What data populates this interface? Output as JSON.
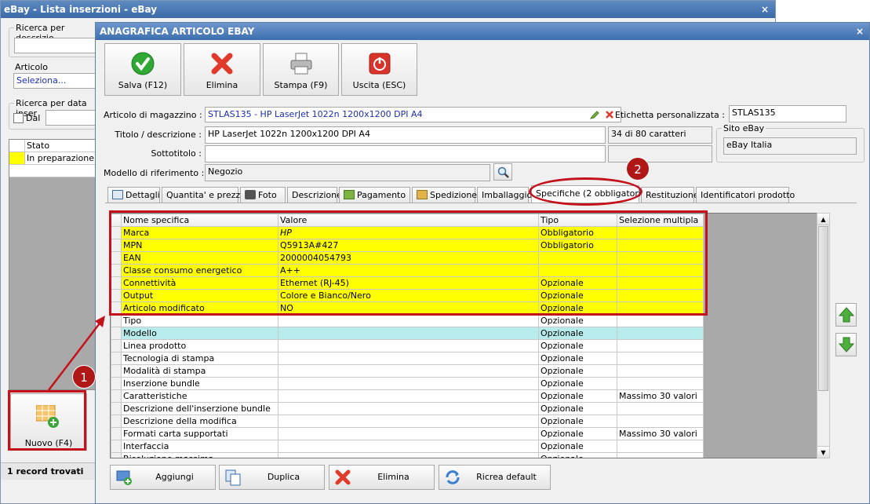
{
  "back": {
    "title": "eBay - Lista inserzioni - eBay",
    "close_glyph": "×",
    "search_desc_label": "Ricerca per descrizio",
    "article_label": "Articolo",
    "article_value": "Seleziona...",
    "date_label": "Ricerca per data inser",
    "dal_label": "Dal",
    "col_stato": "Stato",
    "row_stato": "In preparazione",
    "new_button": "Nuovo (F4)",
    "records": "1 record trovati"
  },
  "front": {
    "title": "ANAGRAFICA ARTICOLO EBAY",
    "close_glyph": "×",
    "toolbar": {
      "save": "Salva (F12)",
      "delete": "Elimina",
      "print": "Stampa (F9)",
      "exit": "Uscita (ESC)"
    },
    "form": {
      "articolo_label": "Articolo di magazzino :",
      "articolo_value": "STLAS135 - HP LaserJet 1022n 1200x1200 DPI A4",
      "etichetta_label": "Etichetta personalizzata :",
      "etichetta_value": "STLAS135",
      "titolo_label": "Titolo / descrizione :",
      "titolo_value": "HP LaserJet 1022n 1200x1200 DPI A4",
      "char_count": "34 di 80 caratteri",
      "sito_label": "Sito eBay",
      "sito_value": "eBay Italia",
      "sottotitolo_label": "Sottotitolo :",
      "modello_label": "Modello di riferimento :",
      "modello_value": "Negozio"
    },
    "tabs": [
      "Dettagli",
      "Quantita' e prezzo",
      "Foto",
      "Descrizione",
      "Pagamento",
      "Spedizione",
      "Imballaggio",
      "Specifiche (2 obbligatorie)",
      "Restituzione",
      "Identificatori prodotto"
    ],
    "grid": {
      "headers": [
        "Nome specifica",
        "Valore",
        "Tipo",
        "Selezione multipla"
      ],
      "rows": [
        [
          "Marca",
          "HP",
          "Obbligatorio",
          ""
        ],
        [
          "MPN",
          "Q5913A#427",
          "Obbligatorio",
          ""
        ],
        [
          "EAN",
          "2000004054793",
          "",
          ""
        ],
        [
          "Classe consumo energetico",
          "A++",
          "",
          ""
        ],
        [
          "Connettività",
          "Ethernet (RJ-45)",
          "Opzionale",
          ""
        ],
        [
          "Output",
          "Colore e Bianco/Nero",
          "Opzionale",
          ""
        ],
        [
          "Articolo modificato",
          "NO",
          "Opzionale",
          ""
        ],
        [
          "Tipo",
          "",
          "Opzionale",
          ""
        ],
        [
          "Modello",
          "",
          "Opzionale",
          ""
        ],
        [
          "Linea prodotto",
          "",
          "Opzionale",
          ""
        ],
        [
          "Tecnologia di stampa",
          "",
          "Opzionale",
          ""
        ],
        [
          "Modalità di stampa",
          "",
          "Opzionale",
          ""
        ],
        [
          "Inserzione bundle",
          "",
          "Opzionale",
          ""
        ],
        [
          "Caratteristiche",
          "",
          "Opzionale",
          "Massimo 30 valori"
        ],
        [
          "Descrizione dell'inserzione bundle",
          "",
          "Opzionale",
          ""
        ],
        [
          "Descrizione della modifica",
          "",
          "Opzionale",
          ""
        ],
        [
          "Formati carta supportati",
          "",
          "Opzionale",
          "Massimo 30 valori"
        ],
        [
          "Interfaccia",
          "",
          "Opzionale",
          ""
        ],
        [
          "Risoluzione massima",
          "",
          "Opzionale",
          ""
        ]
      ]
    },
    "bottom": {
      "add": "Aggiungi",
      "duplicate": "Duplica",
      "delete": "Elimina",
      "reset": "Ricrea default"
    }
  },
  "annotations": {
    "badge1": "1",
    "badge2": "2"
  },
  "colors": {
    "highlight": "#ffff00",
    "selected_row": "#b8ecec",
    "annotation_red": "#c4121c",
    "titlebar": "#3d6eae"
  }
}
